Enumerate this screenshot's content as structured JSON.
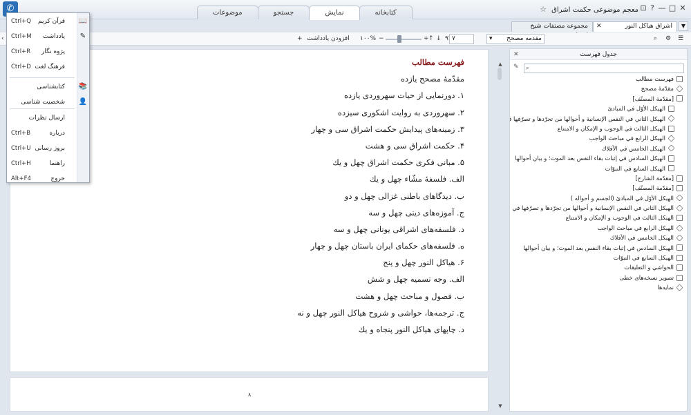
{
  "app": {
    "title": "معجم موضوعی حکمت اشراق",
    "title_star": "☆",
    "logo": "✆"
  },
  "window_controls": [
    "⊡",
    "?",
    "—",
    "□",
    "✕"
  ],
  "main_tabs": [
    {
      "label": "موضوعات",
      "active": false
    },
    {
      "label": "جستجو",
      "active": false
    },
    {
      "label": "نمایش",
      "active": true
    },
    {
      "label": "کتابخانه",
      "active": false
    }
  ],
  "doc_tabs": [
    {
      "label": "مجموعه مصنفات شیخ اشراق",
      "active": false,
      "close": ""
    },
    {
      "label": "اشراق هیاکل النور",
      "active": true,
      "close": "✕"
    }
  ],
  "toolbar": {
    "add_note": "افزودن یادداشت",
    "add_note_icon": "+",
    "zoom_value": "١٠٠%",
    "zoom_minus": "−",
    "zoom_plus": "+",
    "nav_up": "↑",
    "nav_down": "↓",
    "page_value": "٩٦",
    "book_page": "٧",
    "section_select": "مقدمه مصحح",
    "search_icon": "⌕",
    "settings_icon": "⚙",
    "list_icon": "☰",
    "edge_icon": "‹"
  },
  "main_text": [
    {
      "text": "فهرست مطالب",
      "heading": true
    },
    {
      "text": "مقدّمهٔ مصحح یازده"
    },
    {
      "text": "١. دورنمایی از حیات سهروردی یازده"
    },
    {
      "text": "٢. سهروردی به روایت اشکوری سیزده"
    },
    {
      "text": "٣. زمینه‌های پیدایش حکمت اشراق سی و چهار"
    },
    {
      "text": "۴. حکمت اشراق سی و هشت"
    },
    {
      "text": "۵. مبانی فکری حکمت اشراق چهل و یك"
    },
    {
      "text": "الف. فلسفهٔ مشّاء چهل و یك"
    },
    {
      "text": "ب. دیدگاهای باطنی غزالی چهل و دو"
    },
    {
      "text": "ج. آموزه‌های دینی چهل و سه"
    },
    {
      "text": "د. فلسفه‌های اشراقی یونانی چهل و سه"
    },
    {
      "text": "ه. فلسفه‌های حکمای ایران باستان چهل و چهار"
    },
    {
      "text": "۶. هیاکل النور چهل و پنج"
    },
    {
      "text": "الف. وجه تسمیه چهل و شش"
    },
    {
      "text": "ب. فصول و مباحث چهل و هشت"
    },
    {
      "text": "ج. ترجمه‌ها، حواشی و شروح هیاکل النور چهل و نه"
    },
    {
      "text": "د. چاپهای هیاکل النور پنجاه و یك"
    }
  ],
  "scroll": {
    "up": "▲",
    "down": "▼"
  },
  "footer": {
    "page_number": "٨"
  },
  "side_panel": {
    "title": "جدول فهرست",
    "close": "✕",
    "wrench": "✎",
    "search_icon": "⌕",
    "items": [
      {
        "label": "فهرست مطالب",
        "icon": "doc",
        "level": 0
      },
      {
        "label": "مقدّمهٔ مصحح",
        "icon": "cube",
        "level": 0
      },
      {
        "label": "[مقدّمة المصنّف]",
        "icon": "book",
        "level": 0
      },
      {
        "label": "الهيكل الأوّل في المبادئ",
        "icon": "doc",
        "level": 1
      },
      {
        "label": "الهيكل الثاني في النفس الإنسانية و أحوالها من تجرّدها و تصرّفها في",
        "icon": "cube",
        "level": 1
      },
      {
        "label": "الهيكل الثالث في الوجوب و الإمكان و الامتناع",
        "icon": "doc",
        "level": 1
      },
      {
        "label": "الهيكل الرابع في مباحث الواجب",
        "icon": "cube",
        "level": 1
      },
      {
        "label": "الهيكل الخامس في الأفلاك",
        "icon": "cube",
        "level": 1
      },
      {
        "label": "الهيكل السادس في إثبات بقاء النفس بعد الموت؛ و بيان أحوالها",
        "icon": "doc",
        "level": 1
      },
      {
        "label": "الهيكل السابع في النبوّات",
        "icon": "doc",
        "level": 1
      },
      {
        "label": "[مقدّمة الشارح]",
        "icon": "doc",
        "level": 0
      },
      {
        "label": "[مقدّمة المصنّف]",
        "icon": "doc",
        "level": 0
      },
      {
        "label": "الهيكل الأوّل في المبادئ (الجسم و أحواله )",
        "icon": "cube",
        "level": 0
      },
      {
        "label": "الهيكل الثاني في النفس الإنسانية و أحوالها من تجرّدها و تصرّفها في قواه",
        "icon": "cube",
        "level": 0
      },
      {
        "label": "الهيكل الثالث في الوجوب و الإمكان و الامتناع",
        "icon": "doc",
        "level": 0
      },
      {
        "label": "الهيكل الرابع في مباحث الواجب",
        "icon": "cube",
        "level": 0
      },
      {
        "label": "الهيكل الخامس في الأفلاك",
        "icon": "cube",
        "level": 0
      },
      {
        "label": "الهيكل السادس في إثبات بقاء النفس بعد الموت؛ و بيان أحوالها",
        "icon": "doc",
        "level": 0
      },
      {
        "label": "الهيكل السابع في النبوّات",
        "icon": "doc",
        "level": 0
      },
      {
        "label": "الحواشي و التعليقات",
        "icon": "doc",
        "level": 0
      },
      {
        "label": "تصوير نسخه‌هاى خطى",
        "icon": "doc",
        "level": 0
      },
      {
        "label": "نمايه‌ها",
        "icon": "cube",
        "level": 0
      }
    ]
  },
  "menu": {
    "items": [
      {
        "label": "قرآن کریم",
        "shortcut": "Ctrl+Q",
        "icon": "📖"
      },
      {
        "label": "یادداشت",
        "shortcut": "Ctrl+M",
        "icon": "✎"
      },
      {
        "label": "پژوه نگار",
        "shortcut": "Ctrl+R",
        "icon": ""
      },
      {
        "label": "فرهنگ لغت",
        "shortcut": "Ctrl+D",
        "icon": ""
      },
      {
        "label": "کتابشناسی",
        "shortcut": "",
        "icon": "📚"
      },
      {
        "label": "شخصیت شناسی",
        "shortcut": "",
        "icon": "👤"
      },
      {
        "label": "ارسال نظرات",
        "shortcut": "",
        "icon": ""
      },
      {
        "label": "درباره",
        "shortcut": "Ctrl+B",
        "icon": ""
      },
      {
        "label": "بروز رسانی",
        "shortcut": "Ctrl+U",
        "icon": ""
      },
      {
        "label": "راهنما",
        "shortcut": "Ctrl+H",
        "icon": ""
      },
      {
        "label": "خروج",
        "shortcut": "Alt+F4",
        "icon": ""
      }
    ]
  },
  "colors": {
    "heading": "#8b1c1c",
    "accent": "#2b6fb6"
  }
}
